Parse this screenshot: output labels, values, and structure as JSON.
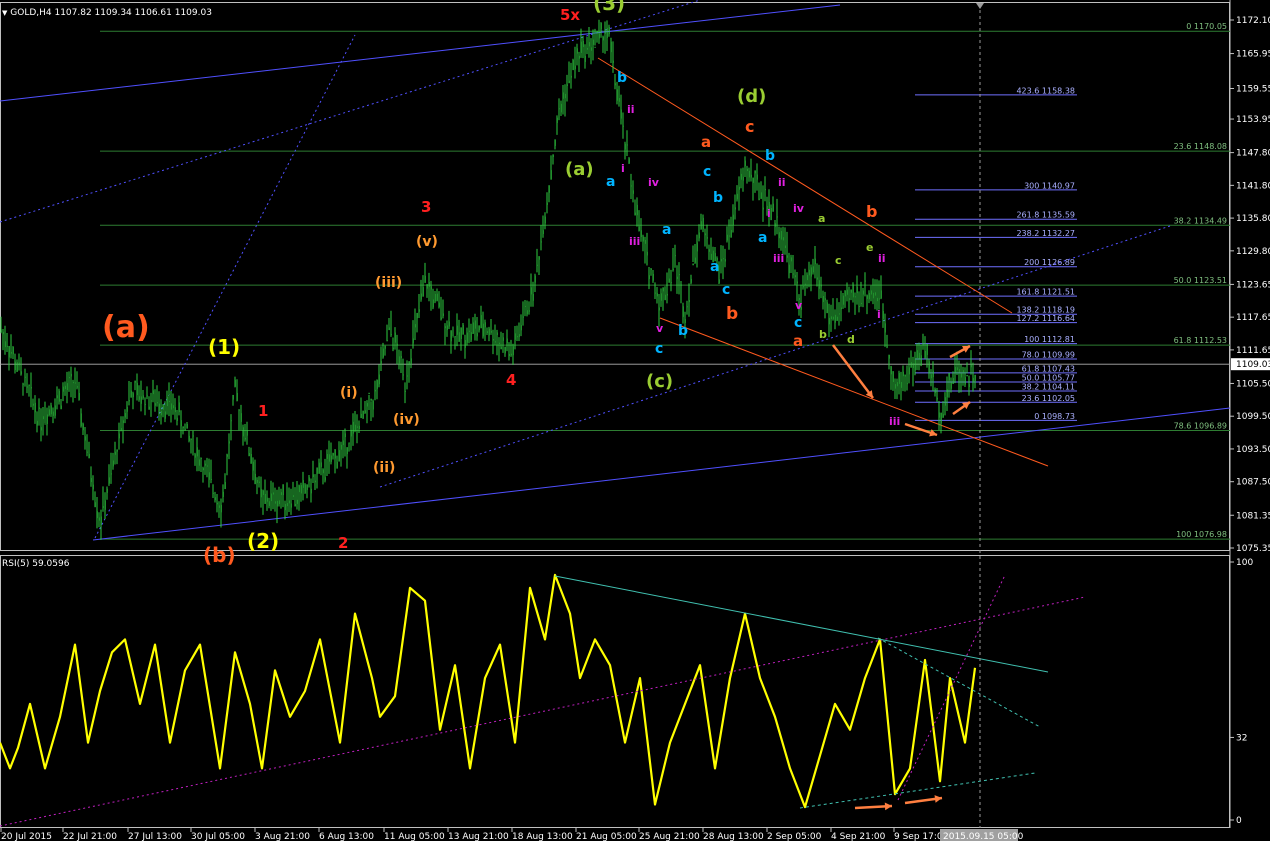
{
  "header": {
    "symbol_line": "GOLD,H4  1107.82 1109.34 1106.61 1109.03",
    "rsi_line": "RSI(5) 59.0596"
  },
  "colors": {
    "background": "#000000",
    "candle": "#2ecc40",
    "price_grid": "#2e7d32",
    "fib_blue": "#6f6fff",
    "rsi_line": "#ffff00",
    "trend_blue": "#5050ff",
    "trend_orange": "#ff5a1f",
    "trend_magenta": "#c020c0",
    "trend_cyan": "#40c0b0",
    "arrow": "#ff7f40"
  },
  "chart_data": [
    {
      "type": "line",
      "title": "GOLD,H4",
      "price_axis": {
        "ticks": [
          "1172.10",
          "1165.95",
          "1159.55",
          "1153.95",
          "1147.80",
          "1141.80",
          "1135.80",
          "1129.80",
          "1123.65",
          "1117.65",
          "1111.65",
          "1105.50",
          "1099.50",
          "1093.50",
          "1087.50",
          "1081.35",
          "1075.35"
        ],
        "current": "1109.03"
      },
      "x_labels": [
        "20 Jul 2015",
        "22 Jul 21:00",
        "27 Jul 13:00",
        "30 Jul 05:00",
        "3 Aug 21:00",
        "6 Aug 13:00",
        "11 Aug 05:00",
        "13 Aug 21:00",
        "18 Aug 13:00",
        "21 Aug 05:00",
        "25 Aug 21:00",
        "28 Aug 13:00",
        "2 Sep 05:00",
        "4 Sep 21:00",
        "9 Sep 17:00"
      ],
      "x_cursor_label": "2015.09.15 05:00",
      "green_levels": [
        {
          "label": "0 1170.05"
        },
        {
          "label": "23.6 1148.08"
        },
        {
          "label": "38.2 1134.49"
        },
        {
          "label": "50.0 1123.51"
        },
        {
          "label": "61.8 1112.53"
        },
        {
          "label": "78.6 1096.89"
        },
        {
          "label": "100 1076.98"
        }
      ],
      "blue_fib_levels": [
        {
          "label": "423.6 1158.38"
        },
        {
          "label": "300 1140.97"
        },
        {
          "label": "261.8 1135.59"
        },
        {
          "label": "238.2 1132.27"
        },
        {
          "label": "200 1126.89"
        },
        {
          "label": "161.8 1121.51"
        },
        {
          "label": "138.2 1118.19"
        },
        {
          "label": "127.2 1116.64"
        },
        {
          "label": "100 1112.81"
        },
        {
          "label": "78.0 1109.99"
        },
        {
          "label": "61.8 1107.43"
        },
        {
          "label": "50.0 1105.77"
        },
        {
          "label": "38.2 1104.11"
        },
        {
          "label": "23.6 1102.05"
        },
        {
          "label": "0 1098.73"
        }
      ],
      "wave_labels": [
        {
          "text": "(a)",
          "color": "#ff5a1f"
        },
        {
          "text": "(1)",
          "color": "#ffff00"
        },
        {
          "text": "1",
          "color": "#ff2020"
        },
        {
          "text": "2",
          "color": "#ff2020"
        },
        {
          "text": "(2)",
          "color": "#ffff00"
        },
        {
          "text": "(b)",
          "color": "#ff5a1f"
        },
        {
          "text": "(i)",
          "color": "#ff9a30"
        },
        {
          "text": "(ii)",
          "color": "#ff9a30"
        },
        {
          "text": "(iii)",
          "color": "#ff9a30"
        },
        {
          "text": "(iv)",
          "color": "#ff9a30"
        },
        {
          "text": "(v)",
          "color": "#ff9a30"
        },
        {
          "text": "3",
          "color": "#ff2020"
        },
        {
          "text": "4",
          "color": "#ff2020"
        },
        {
          "text": "5x",
          "color": "#ff2020"
        },
        {
          "text": "(3)",
          "color": "#9acd32"
        },
        {
          "text": "(a)",
          "color": "#9acd32"
        },
        {
          "text": "(c)",
          "color": "#9acd32"
        },
        {
          "text": "(d)",
          "color": "#9acd32"
        },
        {
          "text": "b",
          "color": "#00b4ff"
        },
        {
          "text": "ii",
          "color": "#e020e0"
        },
        {
          "text": "i",
          "color": "#e020e0"
        },
        {
          "text": "a",
          "color": "#00b4ff"
        },
        {
          "text": "iv",
          "color": "#e020e0"
        },
        {
          "text": "iii",
          "color": "#e020e0"
        },
        {
          "text": "a",
          "color": "#00b4ff"
        },
        {
          "text": "v",
          "color": "#e020e0"
        },
        {
          "text": "c",
          "color": "#00b4ff"
        },
        {
          "text": "b",
          "color": "#00b4ff"
        },
        {
          "text": "a",
          "color": "#ff5a1f"
        },
        {
          "text": "c",
          "color": "#00b4ff"
        },
        {
          "text": "b",
          "color": "#00b4ff"
        },
        {
          "text": "a",
          "color": "#00b4ff"
        },
        {
          "text": "c",
          "color": "#00b4ff"
        },
        {
          "text": "b",
          "color": "#ff5a1f"
        },
        {
          "text": "c",
          "color": "#ff5a1f"
        },
        {
          "text": "b",
          "color": "#00b4ff"
        },
        {
          "text": "ii",
          "color": "#e020e0"
        },
        {
          "text": "i",
          "color": "#e020e0"
        },
        {
          "text": "iv",
          "color": "#e020e0"
        },
        {
          "text": "a",
          "color": "#00b4ff"
        },
        {
          "text": "iii",
          "color": "#e020e0"
        },
        {
          "text": "v",
          "color": "#e020e0"
        },
        {
          "text": "c",
          "color": "#00b4ff"
        },
        {
          "text": "a",
          "color": "#ff5a1f"
        },
        {
          "text": "b",
          "color": "#ff5a1f"
        },
        {
          "text": "a",
          "color": "#9acd32"
        },
        {
          "text": "c",
          "color": "#9acd32"
        },
        {
          "text": "e",
          "color": "#9acd32"
        },
        {
          "text": "ii",
          "color": "#e020e0"
        },
        {
          "text": "b",
          "color": "#9acd32"
        },
        {
          "text": "d",
          "color": "#9acd32"
        },
        {
          "text": "i",
          "color": "#e020e0"
        },
        {
          "text": "iii",
          "color": "#e020e0"
        }
      ]
    },
    {
      "type": "line",
      "title": "RSI(5)",
      "series": [
        {
          "name": "RSI(5)",
          "current": 59.0596
        }
      ],
      "y_ticks": [
        "100",
        "32",
        "0"
      ]
    }
  ]
}
